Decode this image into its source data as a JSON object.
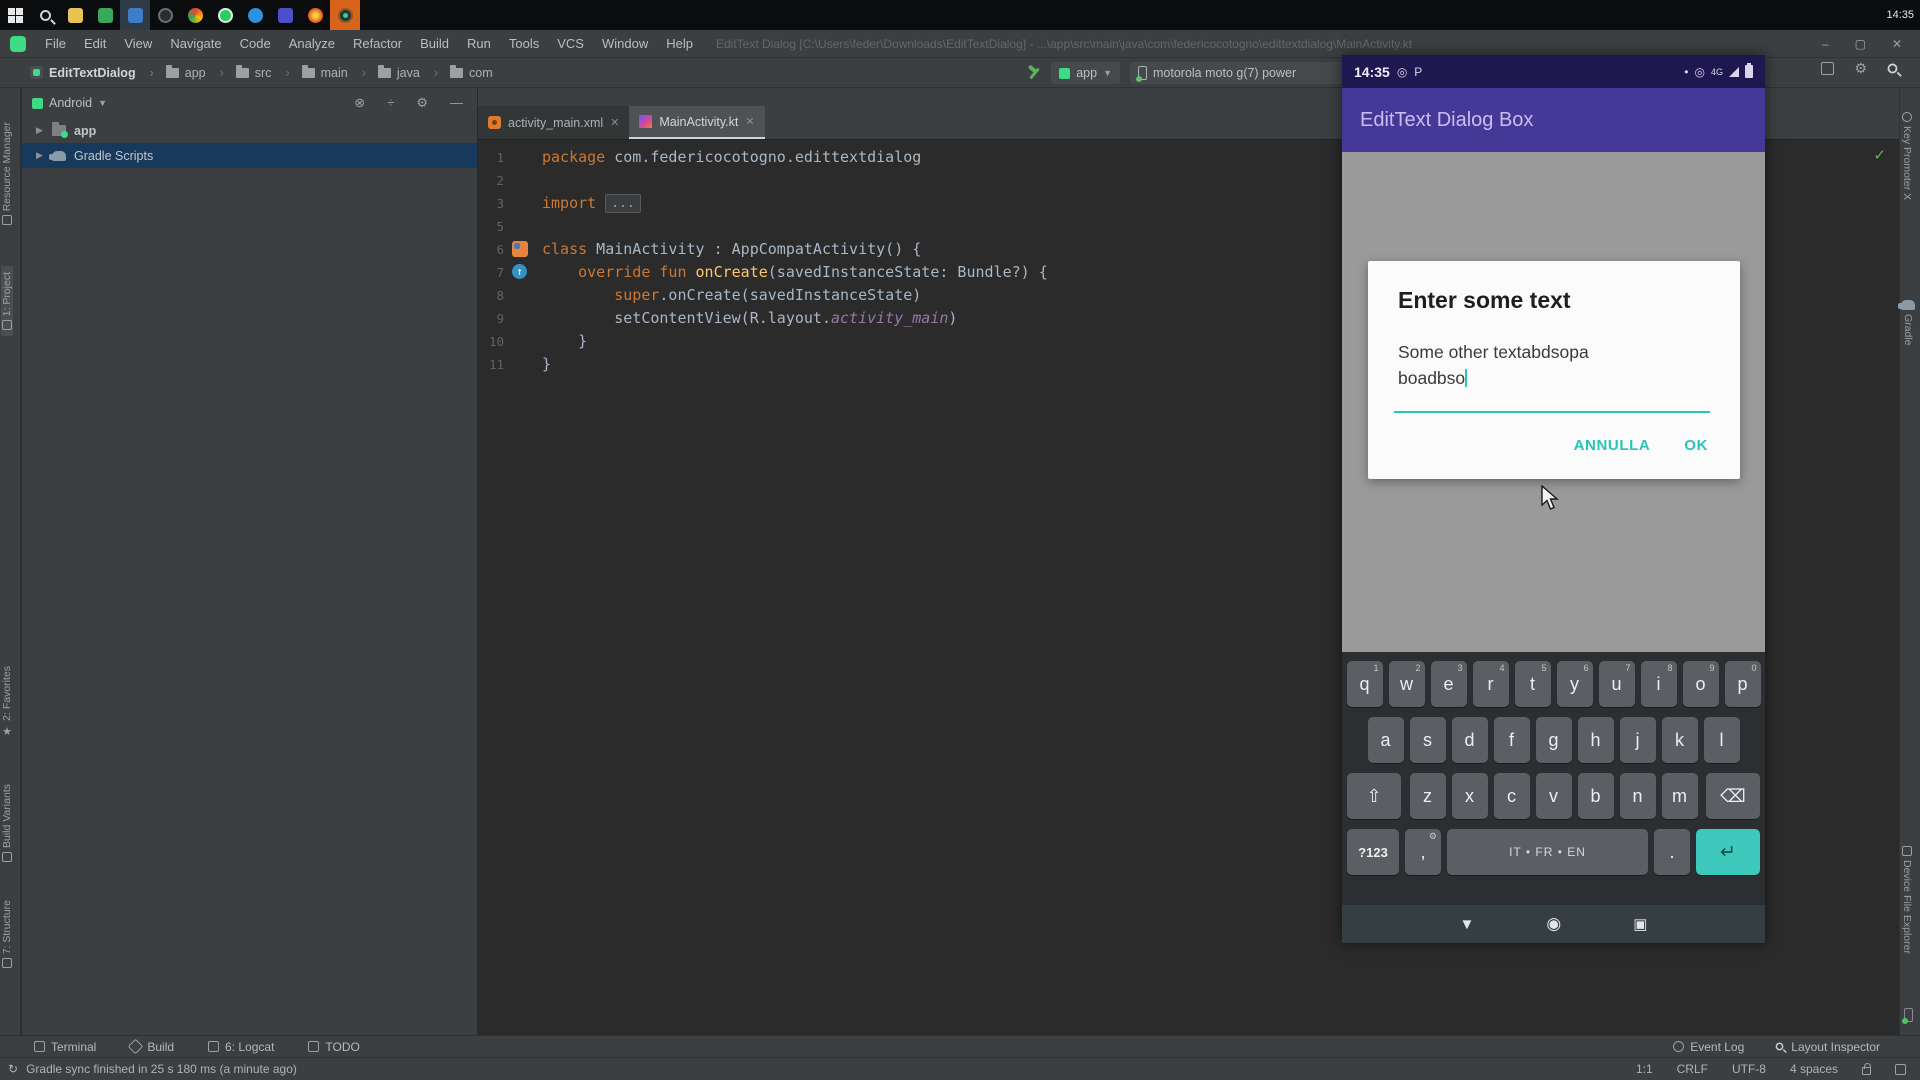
{
  "colors": {
    "accent_teal": "#26c6b7",
    "appbar_purple": "#463897",
    "status_purple": "#1f1750",
    "selection_blue": "#173a5c",
    "keyword_orange": "#cc7832",
    "function_yellow": "#ffc66d",
    "field_purple": "#9876aa",
    "enter_key_teal": "#3ec9bd",
    "taskbar_active_orange": "#d8641c"
  },
  "taskbar": {
    "clock": "14:35"
  },
  "menubar": {
    "items": [
      "File",
      "Edit",
      "View",
      "Navigate",
      "Code",
      "Analyze",
      "Refactor",
      "Build",
      "Run",
      "Tools",
      "VCS",
      "Window",
      "Help"
    ],
    "window_title": "EditText Dialog [C:\\Users\\feder\\Downloads\\EditTextDialog] - ...\\app\\src\\main\\java\\com\\federicocotogno\\edittextdialog\\MainActivity.kt",
    "minimize": "–",
    "maximize": "▢",
    "close": "✕"
  },
  "breadcrumbs": [
    "EditTextDialog",
    "app",
    "src",
    "main",
    "java",
    "com"
  ],
  "toolbar": {
    "run_config": "app",
    "device": "motorola moto g(7) power"
  },
  "left_stripe": [
    "Resource Manager",
    "1: Project",
    "2: Favorites",
    "Build Variants",
    "7: Structure"
  ],
  "right_stripe": [
    "Key Promoter X",
    "Gradle",
    "Device File Explorer"
  ],
  "project": {
    "selector_label": "Android",
    "items": [
      {
        "label": "app"
      },
      {
        "label": "Gradle Scripts"
      }
    ],
    "header_icons": {
      "collapse": "⊗",
      "expand": "÷",
      "settings": "⚙",
      "hide": "—"
    }
  },
  "tabs": [
    {
      "label": "activity_main.xml"
    },
    {
      "label": "MainActivity.kt"
    }
  ],
  "editor": {
    "line_numbers": [
      "1",
      "2",
      "3",
      "5",
      "6",
      "7",
      "8",
      "9",
      "10",
      "11"
    ],
    "override_marker": "↑",
    "code": {
      "l1_kw": "package",
      "l1_rest": " com.federicocotogno.edittextdialog",
      "l3_kw": "import",
      "l3_fold": "...",
      "l6_kw": "class",
      "l6_rest": " MainActivity : AppCompatActivity() {",
      "l7_kw": "override fun ",
      "l7_fn": "onCreate",
      "l7_rest": "(savedInstanceState: Bundle?) {",
      "l8_kw": "super",
      "l8_rest": ".onCreate(savedInstanceState)",
      "l9_pre": "setContentView(R.layout.",
      "l9_field": "activity_main",
      "l9_post": ")",
      "l10": "}",
      "l11": "}"
    },
    "inspection_check": "✓"
  },
  "phone": {
    "status_time": "14:35",
    "status_left_icon1": "◎",
    "status_left_icon2": "P",
    "status_dot": "•",
    "status_circle": "◎",
    "network_label": "4G",
    "appbar_title": "EditText Dialog Box",
    "dialog": {
      "title": "Enter some text",
      "text_line1": "Some other textabdsopa",
      "text_line2": "boadbso",
      "cancel_label": "ANNULLA",
      "ok_label": "OK"
    },
    "keyboard": {
      "row1": [
        {
          "k": "q",
          "h": "1"
        },
        {
          "k": "w",
          "h": "2"
        },
        {
          "k": "e",
          "h": "3"
        },
        {
          "k": "r",
          "h": "4"
        },
        {
          "k": "t",
          "h": "5"
        },
        {
          "k": "y",
          "h": "6"
        },
        {
          "k": "u",
          "h": "7"
        },
        {
          "k": "i",
          "h": "8"
        },
        {
          "k": "o",
          "h": "9"
        },
        {
          "k": "p",
          "h": "0"
        }
      ],
      "row2": [
        "a",
        "s",
        "d",
        "f",
        "g",
        "h",
        "j",
        "k",
        "l"
      ],
      "row3": [
        "z",
        "x",
        "c",
        "v",
        "b",
        "n",
        "m"
      ],
      "shift_glyph": "⇧",
      "backspace_glyph": "⌫",
      "symbols_key": "?123",
      "comma_key": ",",
      "comma_hint": "⚙",
      "space_key": "IT • FR • EN",
      "period_key": ".",
      "enter_glyph": "↵"
    },
    "nav": {
      "back": "▼",
      "home": "◉",
      "recents": "▣"
    }
  },
  "bottom_toolbar": {
    "left": [
      "Terminal",
      "Build",
      "6: Logcat",
      "TODO"
    ],
    "right": [
      "Event Log",
      "Layout Inspector"
    ]
  },
  "statusbar": {
    "refresh_glyph": "↻",
    "message": "Gradle sync finished in 25 s 180 ms (a minute ago)",
    "caret": "1:1",
    "line_ending": "CRLF",
    "encoding": "UTF-8",
    "indent": "4 spaces"
  }
}
